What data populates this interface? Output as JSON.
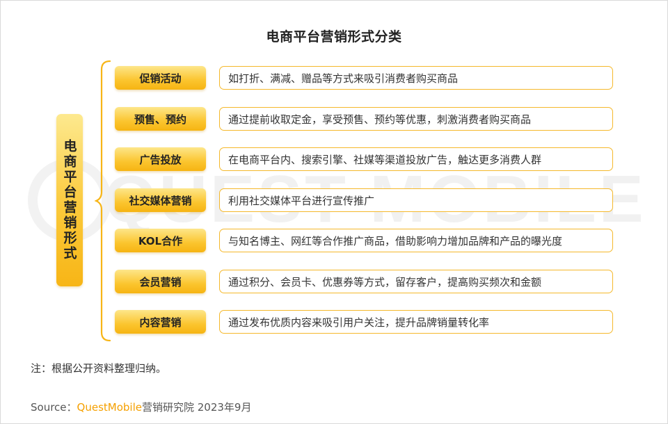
{
  "title": "电商平台营销形式分类",
  "watermark": {
    "text": "QUEST MOBILE"
  },
  "root": {
    "label": "电商平台营销形式"
  },
  "rows": [
    {
      "category": "促销活动",
      "description": "如打折、满减、赠品等方式来吸引消费者购买商品"
    },
    {
      "category": "预售、预约",
      "description": "通过提前收取定金，享受预售、预约等优惠，刺激消费者购买商品"
    },
    {
      "category": "广告投放",
      "description": "在电商平台内、搜索引擎、社媒等渠道投放广告，触达更多消费人群"
    },
    {
      "category": "社交媒体营销",
      "description": "利用社交媒体平台进行宣传推广"
    },
    {
      "category": "KOL合作",
      "description": "与知名博主、网红等合作推广商品，借助影响力增加品牌和产品的曝光度"
    },
    {
      "category": "会员营销",
      "description": "通过积分、会员卡、优惠券等方式，留存客户，提高购买频次和金额"
    },
    {
      "category": "内容营销",
      "description": "通过发布优质内容来吸引用户关注，提升品牌销量转化率"
    }
  ],
  "note": "注：根据公开资料整理归纳。",
  "source": {
    "prefix": "Source：",
    "brand": "QuestMobile",
    "suffix": "营销研究院 2023年9月"
  },
  "colors": {
    "accent": "#f7b516",
    "border": "#f5b82a",
    "brand": "#f5a000"
  }
}
